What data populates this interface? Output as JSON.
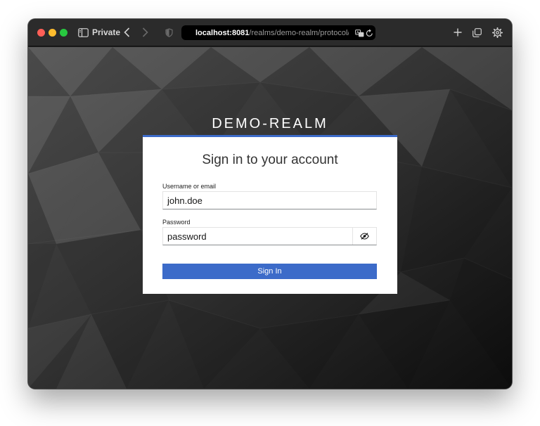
{
  "browser": {
    "mode_label": "Private",
    "url_host": "localhost:8081",
    "url_path": "/realms/demo-realm/protocol/openid-connect/auth",
    "icons": [
      "sidebar-icon",
      "back-icon",
      "forward-icon",
      "shield-icon",
      "translate-icon",
      "reload-icon",
      "new-tab-icon",
      "tabs-icon",
      "settings-icon"
    ]
  },
  "page": {
    "realm_name": "DEMO-REALM",
    "card_title": "Sign in to your account",
    "username": {
      "label": "Username or email",
      "value": "john.doe"
    },
    "password": {
      "label": "Password",
      "value": "password"
    },
    "sign_in_label": "Sign In"
  },
  "colors": {
    "accent": "#3c6bc9",
    "card_bg": "#ffffff",
    "background": "#2a2a2a"
  }
}
